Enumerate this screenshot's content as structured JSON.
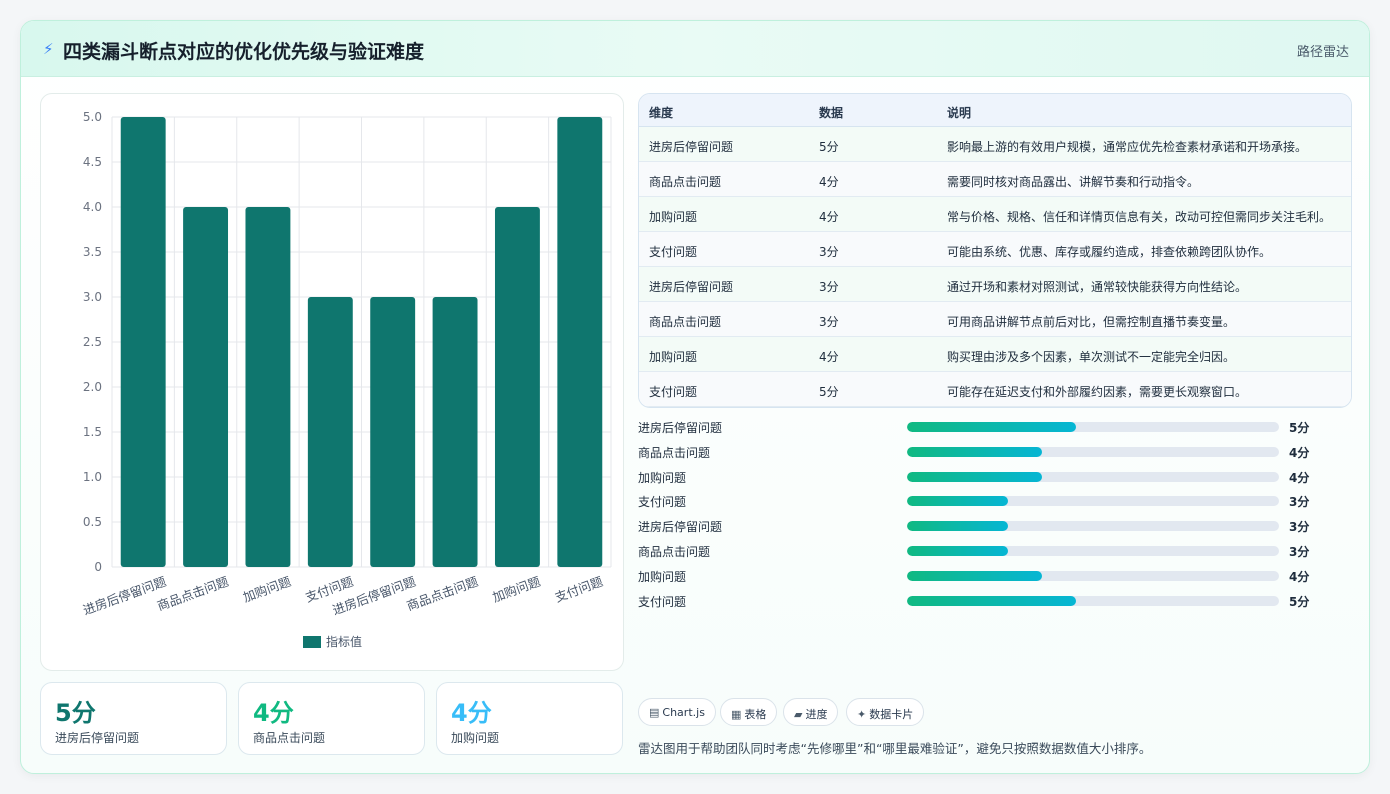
{
  "header": {
    "title": "四类漏斗断点对应的优化优先级与验证难度",
    "tag": "路径雷达"
  },
  "colors": {
    "bar": "#0f766e",
    "accent_green": "#10b981",
    "accent_cyan": "#06b6d4",
    "kpi1": "#0f766e",
    "kpi2": "#10b981",
    "kpi3": "#38bdf8"
  },
  "chart_data": {
    "type": "bar",
    "categories": [
      "进房后停留问题",
      "商品点击问题",
      "加购问题",
      "支付问题",
      "进房后停留问题",
      "商品点击问题",
      "加购问题",
      "支付问题"
    ],
    "series": [
      {
        "name": "指标值",
        "values": [
          5,
          4,
          4,
          3,
          3,
          3,
          4,
          5
        ]
      }
    ],
    "ylim": [
      0,
      5
    ],
    "yticks": [
      "0",
      "0.5",
      "1.0",
      "1.5",
      "2.0",
      "2.5",
      "3.0",
      "3.5",
      "4.0",
      "4.5",
      "5.0"
    ],
    "grid": true,
    "legend": "bottom"
  },
  "table": {
    "headers": [
      "维度",
      "数据",
      "说明"
    ],
    "rows": [
      {
        "dim": "进房后停留问题",
        "val": "5分",
        "desc": "影响最上游的有效用户规模，通常应优先检查素材承诺和开场承接。"
      },
      {
        "dim": "商品点击问题",
        "val": "4分",
        "desc": "需要同时核对商品露出、讲解节奏和行动指令。"
      },
      {
        "dim": "加购问题",
        "val": "4分",
        "desc": "常与价格、规格、信任和详情页信息有关，改动可控但需同步关注毛利。"
      },
      {
        "dim": "支付问题",
        "val": "3分",
        "desc": "可能由系统、优惠、库存或履约造成，排查依赖跨团队协作。"
      },
      {
        "dim": "进房后停留问题",
        "val": "3分",
        "desc": "通过开场和素材对照测试，通常较快能获得方向性结论。"
      },
      {
        "dim": "商品点击问题",
        "val": "3分",
        "desc": "可用商品讲解节点前后对比，但需控制直播节奏变量。"
      },
      {
        "dim": "加购问题",
        "val": "4分",
        "desc": "购买理由涉及多个因素，单次测试不一定能完全归因。"
      },
      {
        "dim": "支付问题",
        "val": "5分",
        "desc": "可能存在延迟支付和外部履约因素，需要更长观察窗口。"
      }
    ]
  },
  "progress": [
    {
      "label": "进房后停留问题",
      "value": 5,
      "text": "5分"
    },
    {
      "label": "商品点击问题",
      "value": 4,
      "text": "4分"
    },
    {
      "label": "加购问题",
      "value": 4,
      "text": "4分"
    },
    {
      "label": "支付问题",
      "value": 3,
      "text": "3分"
    },
    {
      "label": "进房后停留问题",
      "value": 3,
      "text": "3分"
    },
    {
      "label": "商品点击问题",
      "value": 3,
      "text": "3分"
    },
    {
      "label": "加购问题",
      "value": 4,
      "text": "4分"
    },
    {
      "label": "支付问题",
      "value": 5,
      "text": "5分"
    }
  ],
  "kpis": [
    {
      "value": "5分",
      "label": "进房后停留问题"
    },
    {
      "value": "4分",
      "label": "商品点击问题"
    },
    {
      "value": "4分",
      "label": "加购问题"
    }
  ],
  "pills": [
    {
      "icon": "▤",
      "icon_name": "chart-icon",
      "label": "Chart.js"
    },
    {
      "icon": "▦",
      "icon_name": "table-icon",
      "label": "表格"
    },
    {
      "icon": "▰",
      "icon_name": "progress-icon",
      "label": "进度"
    },
    {
      "icon": "✦",
      "icon_name": "sparkle-icon",
      "label": "数据卡片"
    }
  ],
  "note": "雷达图用于帮助团队同时考虑“先修哪里”和“哪里最难验证”，避免只按照数据数值大小排序。"
}
